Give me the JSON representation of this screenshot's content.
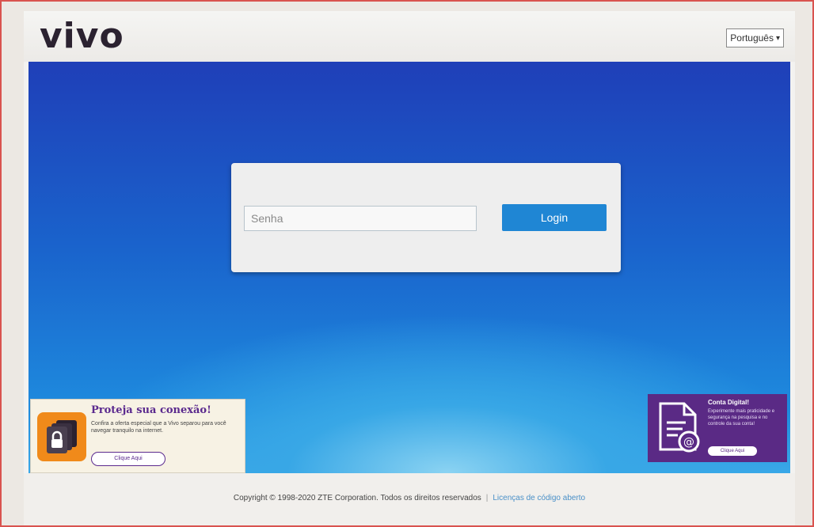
{
  "header": {
    "logo_text": "vivo",
    "language": {
      "selected": "Português",
      "icon": "chevron-down-icon"
    }
  },
  "login": {
    "password_placeholder": "Senha",
    "login_button_label": "Login"
  },
  "promo_left": {
    "title": "Proteja sua conexão!",
    "description": "Confira a oferta especial que a Vivo separou para você navegar tranquilo na internet.",
    "cta_label": "Clique Aqui",
    "icon": "lock-devices-icon"
  },
  "promo_right": {
    "title": "Conta Digital!",
    "description": "Experimente mais praticidade e segurança na pesquisa e no controle da sua conta!",
    "cta_label": "Clique Aqui",
    "icon": "document-email-icon"
  },
  "footer": {
    "copyright": "Copyright © 1998-2020 ZTE Corporation. Todos os direitos reservados",
    "separator": "|",
    "license_link": "Licenças de código aberto"
  },
  "colors": {
    "brand_purple": "#5a2a85",
    "login_button": "#1f86d4",
    "background_blue": "#1a63cc"
  }
}
